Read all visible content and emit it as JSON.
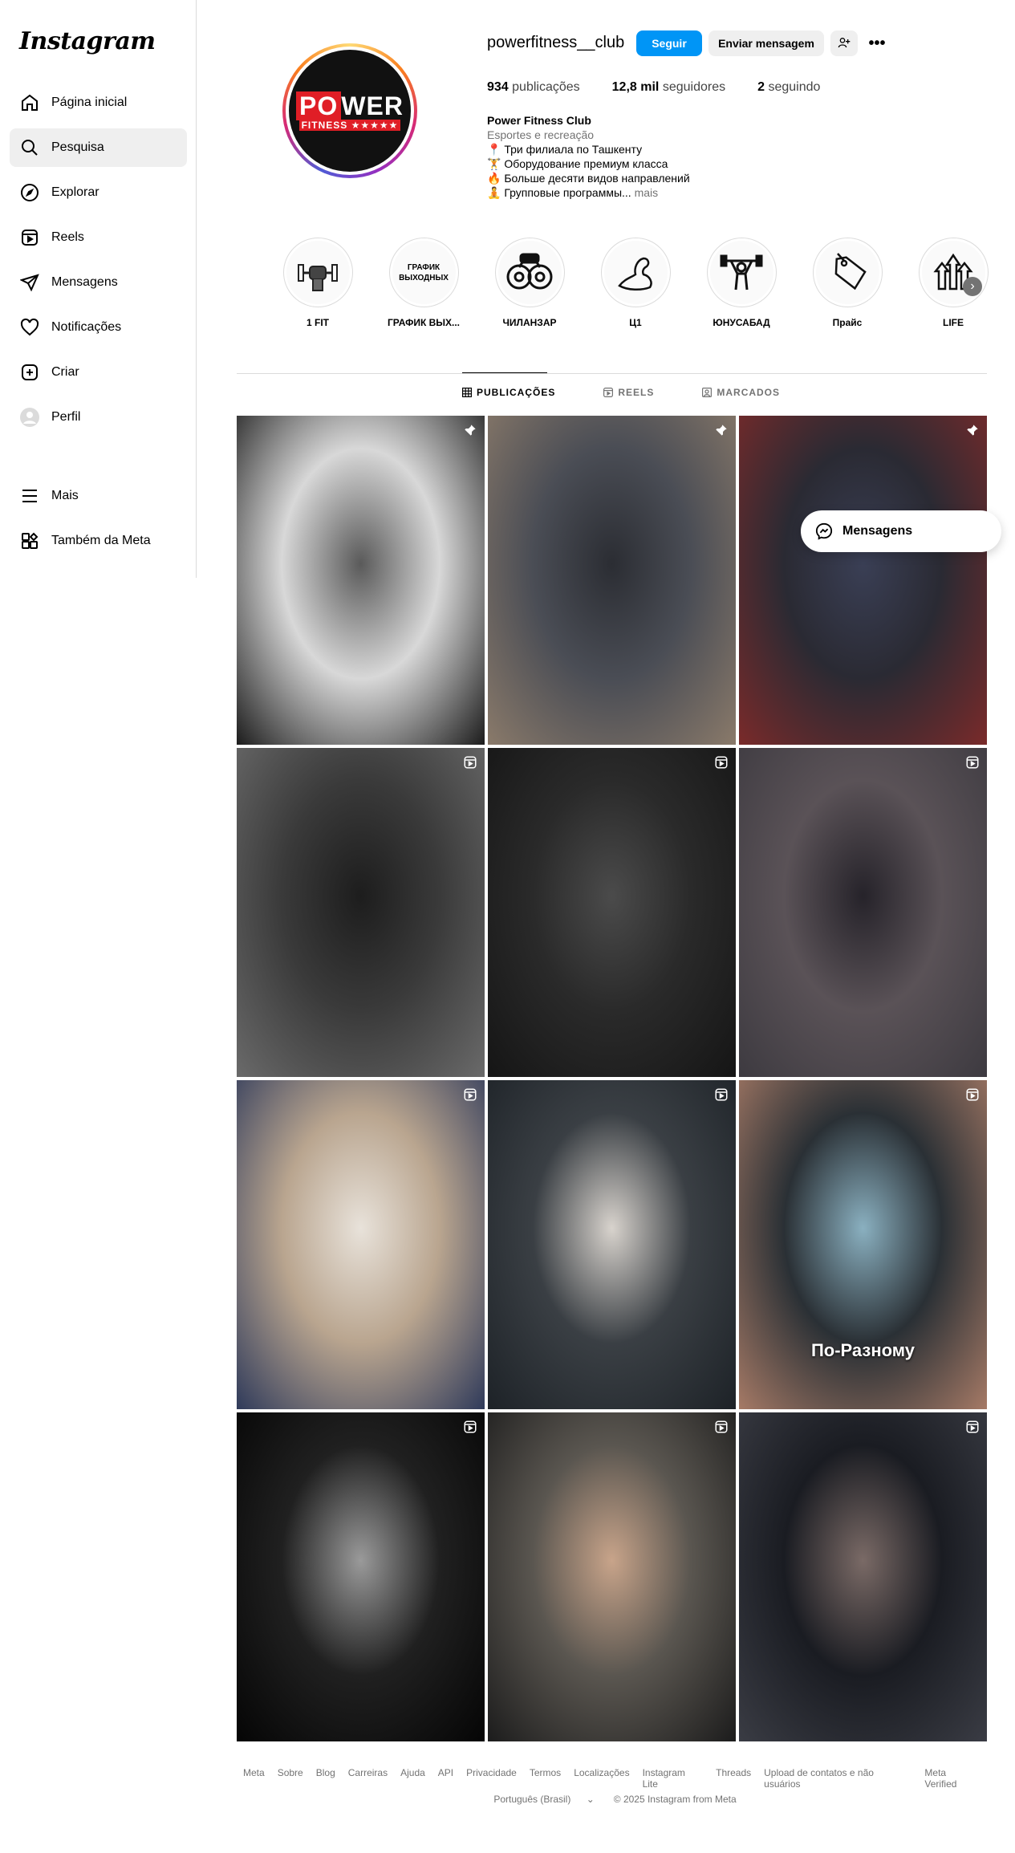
{
  "app": {
    "logo_text": "Instagram"
  },
  "sidebar": {
    "items": [
      {
        "label": "Página inicial",
        "icon": "home-icon"
      },
      {
        "label": "Pesquisa",
        "icon": "search-icon",
        "active": true
      },
      {
        "label": "Explorar",
        "icon": "compass-icon"
      },
      {
        "label": "Reels",
        "icon": "reels-icon"
      },
      {
        "label": "Mensagens",
        "icon": "send-icon"
      },
      {
        "label": "Notificações",
        "icon": "heart-icon"
      },
      {
        "label": "Criar",
        "icon": "plus-square-icon"
      },
      {
        "label": "Perfil",
        "icon": "avatar-icon"
      }
    ],
    "bottom": [
      {
        "label": "Mais",
        "icon": "menu-icon"
      },
      {
        "label": "Também da Meta",
        "icon": "meta-apps-icon"
      }
    ]
  },
  "profile": {
    "avatar_line1_a": "PO",
    "avatar_line1_b": "WER",
    "avatar_line2": "FITNESS ★★★★★",
    "username": "powerfitness__club",
    "follow_label": "Seguir",
    "message_label": "Enviar mensagem",
    "more_label": "•••",
    "stats": {
      "posts_value": "934",
      "posts_label": "publicações",
      "followers_value": "12,8 mil",
      "followers_label": "seguidores",
      "following_value": "2",
      "following_label": "seguindo"
    },
    "bio": {
      "name": "Power Fitness Club",
      "category": "Esportes e recreação",
      "lines": [
        "📍 Три филиала по Ташкенту",
        "🏋️ Оборудование премиум класса",
        "🔥 Больше десяти видов направлений",
        "🧘 Групповые программы..."
      ],
      "more": "mais"
    }
  },
  "highlights": [
    {
      "label": "1 FIT",
      "art": "fist-dumbbell"
    },
    {
      "label": "ГРАФИК ВЫХ...",
      "art_text": "ГРАФИК ВЫХОДНЫХ"
    },
    {
      "label": "ЧИЛАНЗАР",
      "art": "dumbbell"
    },
    {
      "label": "Ц1",
      "art": "arm"
    },
    {
      "label": "ЮНУСАБАД",
      "art": "lifter"
    },
    {
      "label": "Прайс",
      "art": "price-tag"
    },
    {
      "label": "LIFE",
      "art": "arrows-up"
    }
  ],
  "tabs": [
    {
      "label": "PUBLICAÇÕES",
      "icon": "grid-icon",
      "active": true
    },
    {
      "label": "REELS",
      "icon": "reels-icon"
    },
    {
      "label": "MARCADOS",
      "icon": "tagged-icon"
    }
  ],
  "posts": [
    {
      "type": "pinned",
      "colors": [
        "#d8d8d8",
        "#5a5a5a",
        "#1c1c1c"
      ]
    },
    {
      "type": "pinned",
      "colors": [
        "#4a4d55",
        "#2b2d33",
        "#8a7a6a"
      ]
    },
    {
      "type": "pinned",
      "colors": [
        "#2a2a33",
        "#3a3f55",
        "#7a2a2a"
      ]
    },
    {
      "type": "reel",
      "colors": [
        "#3a3a3a",
        "#1d1d1d",
        "#6a6a6a"
      ]
    },
    {
      "type": "reel",
      "colors": [
        "#2a2a2a",
        "#4b4b4b",
        "#151515"
      ]
    },
    {
      "type": "reel",
      "colors": [
        "#5a5257",
        "#26232a",
        "#3d3a40"
      ]
    },
    {
      "type": "reel",
      "colors": [
        "#b9a58f",
        "#e8e2da",
        "#2f3a5a"
      ]
    },
    {
      "type": "reel",
      "colors": [
        "#3a3f44",
        "#d8d3cd",
        "#1d2227"
      ]
    },
    {
      "type": "reel",
      "colors": [
        "#2a3035",
        "#8ab0c0",
        "#a67a66"
      ],
      "caption": "По-Разному"
    },
    {
      "type": "reel",
      "colors": [
        "#202020",
        "#9a9a9a",
        "#050505"
      ]
    },
    {
      "type": "reel",
      "colors": [
        "#5a5650",
        "#c8a48a",
        "#1c1c1c"
      ]
    },
    {
      "type": "reel",
      "colors": [
        "#1a1c22",
        "#7a6a66",
        "#3a3c44"
      ]
    }
  ],
  "floating": {
    "label": "Mensagens"
  },
  "footer": {
    "links": [
      "Meta",
      "Sobre",
      "Blog",
      "Carreiras",
      "Ajuda",
      "API",
      "Privacidade",
      "Termos",
      "Localizações",
      "Instagram Lite",
      "Threads",
      "Upload de contatos e não usuários",
      "Meta Verified"
    ],
    "language": "Português (Brasil)",
    "copyright": "© 2025 Instagram from Meta"
  },
  "colors": {
    "accent": "#0095f6",
    "muted": "#737373",
    "border": "#dbdbdb"
  }
}
